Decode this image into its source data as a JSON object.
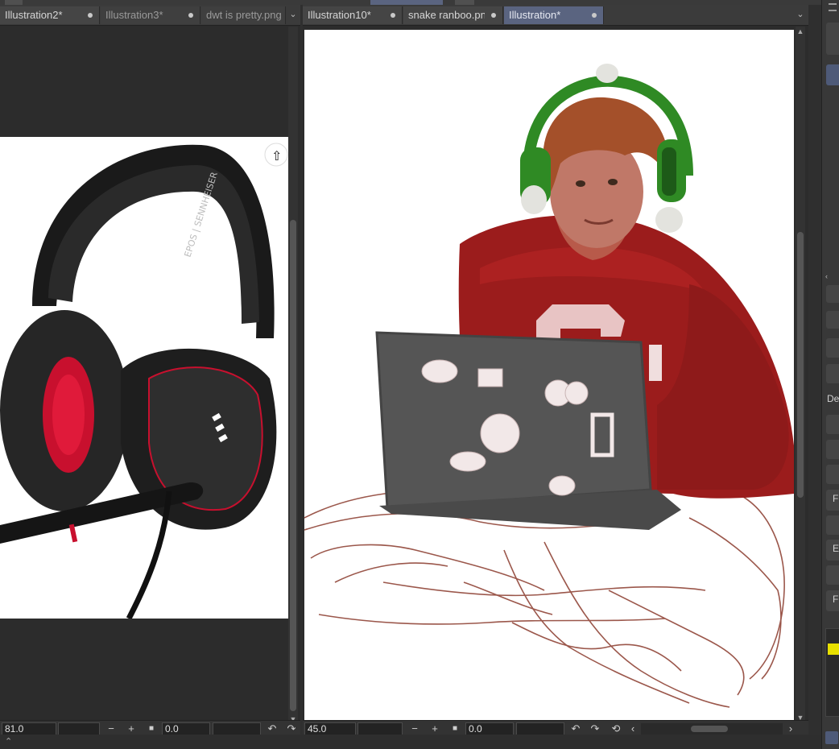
{
  "left_pane": {
    "tabs": [
      {
        "label": "Illustration2*",
        "state": "normal"
      },
      {
        "label": "Illustration3*",
        "state": "inactive"
      },
      {
        "label": "dwt is pretty.png",
        "state": "inactive"
      }
    ],
    "zoom": "81.0",
    "rotation": "0.0"
  },
  "right_pane": {
    "tabs": [
      {
        "label": "Illustration10*",
        "state": "normal"
      },
      {
        "label": "snake ranboo.png",
        "state": "normal"
      },
      {
        "label": "Illustration*",
        "state": "active"
      }
    ],
    "zoom": "45.0",
    "rotation": "0.0"
  },
  "status_icons": {
    "zoom_out": "−",
    "zoom_in": "+",
    "stop": "■",
    "rotate_left": "↶",
    "rotate_right": "↷",
    "reset_rotation": "⟲",
    "scroll_left": "‹",
    "scroll_right": "›",
    "menu": "⌄"
  },
  "side_panel": {
    "labels": [
      "De",
      "F",
      "E",
      "F"
    ]
  },
  "colors": {
    "active_tab": "#5a6480",
    "hoodie_red": "#9b1c1c",
    "headphone_green": "#2f8a24",
    "hair": "#a4502a",
    "laptop": "#555555",
    "sketch_line": "#8a3a2c"
  }
}
